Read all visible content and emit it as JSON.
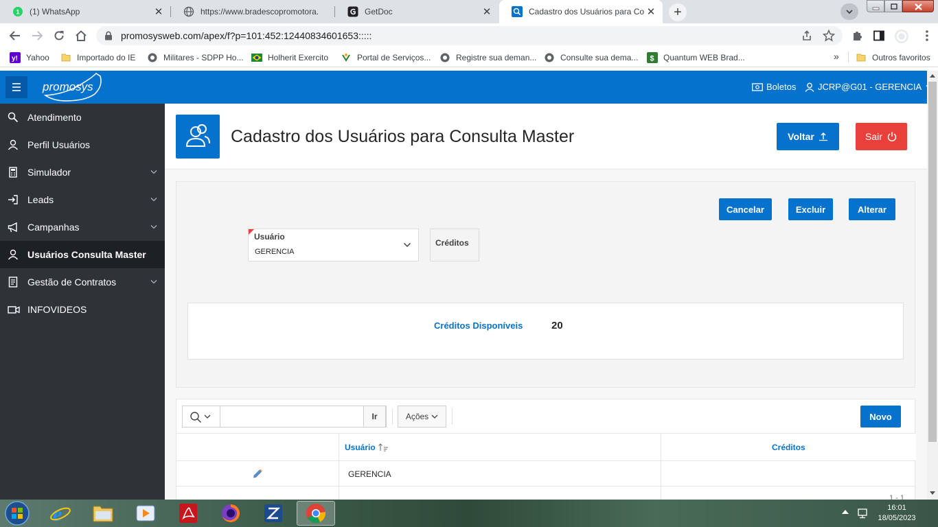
{
  "browser": {
    "tabs": [
      {
        "title": "(1) WhatsApp",
        "active": false
      },
      {
        "title": "https://www.bradescopromotora.",
        "active": false
      },
      {
        "title": "GetDoc",
        "active": false
      },
      {
        "title": "Cadastro dos Usuários para Cons",
        "active": true
      }
    ],
    "url": "promosysweb.com/apex/f?p=101:452:12440834601653:::::",
    "bookmarks": [
      "Yahoo",
      "Importado do IE",
      "Militares - SDPP Ho...",
      "Holherit Exercito",
      "Portal de Serviços...",
      "Registre sua deman...",
      "Consulte sua dema...",
      "Quantum WEB Brad..."
    ],
    "bookmarks_overflow": "»",
    "other_bookmarks": "Outros favoritos"
  },
  "app": {
    "logo_text": "promosys",
    "header_links": {
      "boletos": "Boletos",
      "user": "JCRP@G01 - GERENCIA"
    },
    "nav": [
      {
        "label": "Atendimento",
        "icon": "search-icon",
        "expandable": false
      },
      {
        "label": "Perfil Usuários",
        "icon": "user-icon",
        "expandable": false
      },
      {
        "label": "Simulador",
        "icon": "calculator-icon",
        "expandable": true
      },
      {
        "label": "Leads",
        "icon": "sign-in-icon",
        "expandable": true
      },
      {
        "label": "Campanhas",
        "icon": "megaphone-icon",
        "expandable": true
      },
      {
        "label": "Usuários Consulta Master",
        "icon": "user-icon",
        "expandable": false,
        "current": true
      },
      {
        "label": "Gestão de Contratos",
        "icon": "document-icon",
        "expandable": true
      },
      {
        "label": "INFOVIDEOS",
        "icon": "video-icon",
        "expandable": false
      }
    ],
    "page_title": "Cadastro dos Usuários para Consulta Master",
    "buttons": {
      "voltar": "Voltar",
      "sair": "Sair",
      "cancelar": "Cancelar",
      "excluir": "Excluir",
      "alterar": "Alterar",
      "ir": "Ir",
      "acoes": "Ações",
      "novo": "Novo"
    },
    "form": {
      "usuario_label": "Usuário",
      "usuario_value": "GERENCIA",
      "creditos_label": "Créditos"
    },
    "credits_panel": {
      "label": "Créditos Disponíveis",
      "value": "20"
    },
    "report": {
      "columns": [
        "Usuário",
        "Créditos"
      ],
      "rows": [
        {
          "usuario": "GERENCIA",
          "creditos": ""
        }
      ],
      "pagination": "1 - 1"
    }
  },
  "taskbar": {
    "time": "16:01",
    "date": "18/05/2023"
  },
  "colors": {
    "accent": "#0572ce",
    "danger": "#e8413c",
    "sidebar": "#2e3338"
  }
}
